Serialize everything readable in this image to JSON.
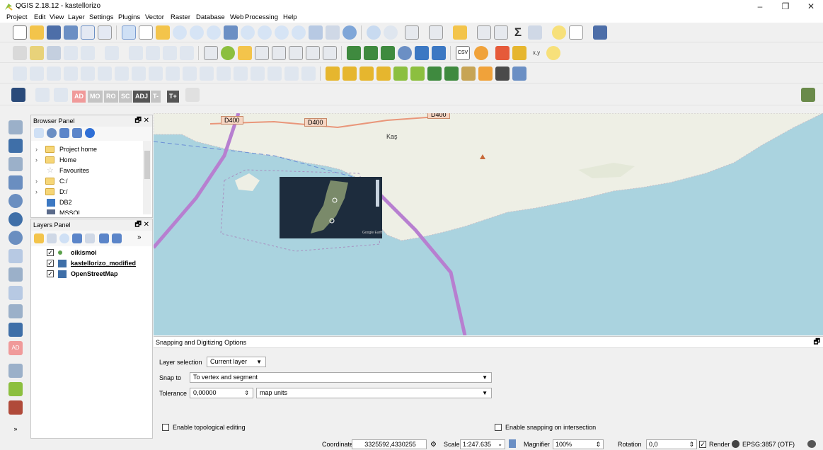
{
  "window": {
    "title": "QGIS 2.18.12 - kastellorizo"
  },
  "menu": [
    "Project",
    "Edit",
    "View",
    "Layer",
    "Settings",
    "Plugins",
    "Vector",
    "Raster",
    "Database",
    "Web",
    "Processing",
    "Help"
  ],
  "toolbar4": {
    "ad": "AD",
    "mo": "MO",
    "ro": "RO",
    "sc": "SC",
    "adj": "ADJ",
    "tminus": "T-",
    "tplus": "T+"
  },
  "browser_panel": {
    "title": "Browser Panel",
    "items": [
      "Project home",
      "Home",
      "Favourites",
      "C:/",
      "D:/",
      "DB2",
      "MSSQL"
    ]
  },
  "layers_panel": {
    "title": "Layers Panel",
    "layers": [
      {
        "name": "oikismoi",
        "checked": true
      },
      {
        "name": "kastellorizo_modified",
        "checked": true
      },
      {
        "name": "OpenStreetMap",
        "checked": true
      }
    ]
  },
  "map": {
    "road_labels": [
      "D400",
      "D400",
      "D400"
    ],
    "town_label": "Kaş",
    "raster_watermark": "Google Earth"
  },
  "snapping": {
    "title": "Snapping and Digitizing Options",
    "layer_selection_label": "Layer selection",
    "layer_selection_value": "Current layer",
    "snap_to_label": "Snap to",
    "snap_to_value": "To vertex and segment",
    "tolerance_label": "Tolerance",
    "tolerance_value": "0,00000",
    "tolerance_units": "map units",
    "topological_label": "Enable topological editing",
    "intersection_label": "Enable snapping on intersection"
  },
  "status": {
    "coordinate_label": "Coordinate",
    "coordinate_value": "3325592,4330255",
    "scale_label": "Scale",
    "scale_value": "1:247.635",
    "magnifier_label": "Magnifier",
    "magnifier_value": "100%",
    "rotation_label": "Rotation",
    "rotation_value": "0,0",
    "render_label": "Render",
    "crs_label": "EPSG:3857 (OTF)"
  },
  "colors": {
    "sea": "#aad3df",
    "land": "#eeefe5",
    "border": "#b77fd0",
    "road": "#e9967a"
  }
}
